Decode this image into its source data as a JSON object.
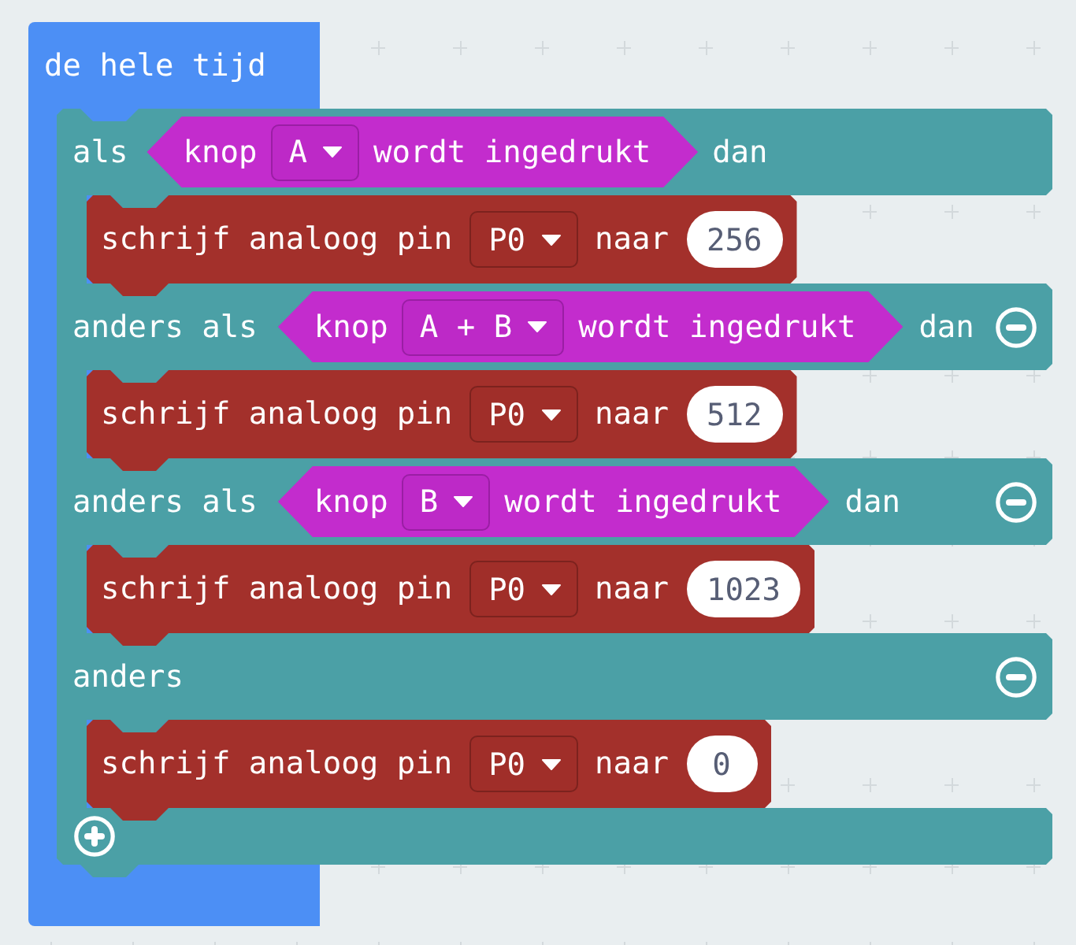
{
  "event_block": {
    "label": "de hele tijd"
  },
  "if_block": {
    "branches": [
      {
        "kind": "if",
        "keyword": "als",
        "condition": {
          "label": "knop",
          "button": "A",
          "suffix": "wordt ingedrukt"
        },
        "then": "dan",
        "removable": false,
        "statement": {
          "label": "schrijf analoog pin",
          "pin": "P0",
          "to": "naar",
          "value": "256"
        }
      },
      {
        "kind": "else_if",
        "keyword": "anders als",
        "condition": {
          "label": "knop",
          "button": "A + B",
          "suffix": "wordt ingedrukt"
        },
        "then": "dan",
        "removable": true,
        "statement": {
          "label": "schrijf analoog pin",
          "pin": "P0",
          "to": "naar",
          "value": "512"
        }
      },
      {
        "kind": "else_if",
        "keyword": "anders als",
        "condition": {
          "label": "knop",
          "button": "B",
          "suffix": "wordt ingedrukt"
        },
        "then": "dan",
        "removable": true,
        "statement": {
          "label": "schrijf analoog pin",
          "pin": "P0",
          "to": "naar",
          "value": "1023"
        }
      },
      {
        "kind": "else",
        "keyword": "anders",
        "removable": true,
        "statement": {
          "label": "schrijf analoog pin",
          "pin": "P0",
          "to": "naar",
          "value": "0"
        }
      }
    ],
    "addable": true
  }
}
